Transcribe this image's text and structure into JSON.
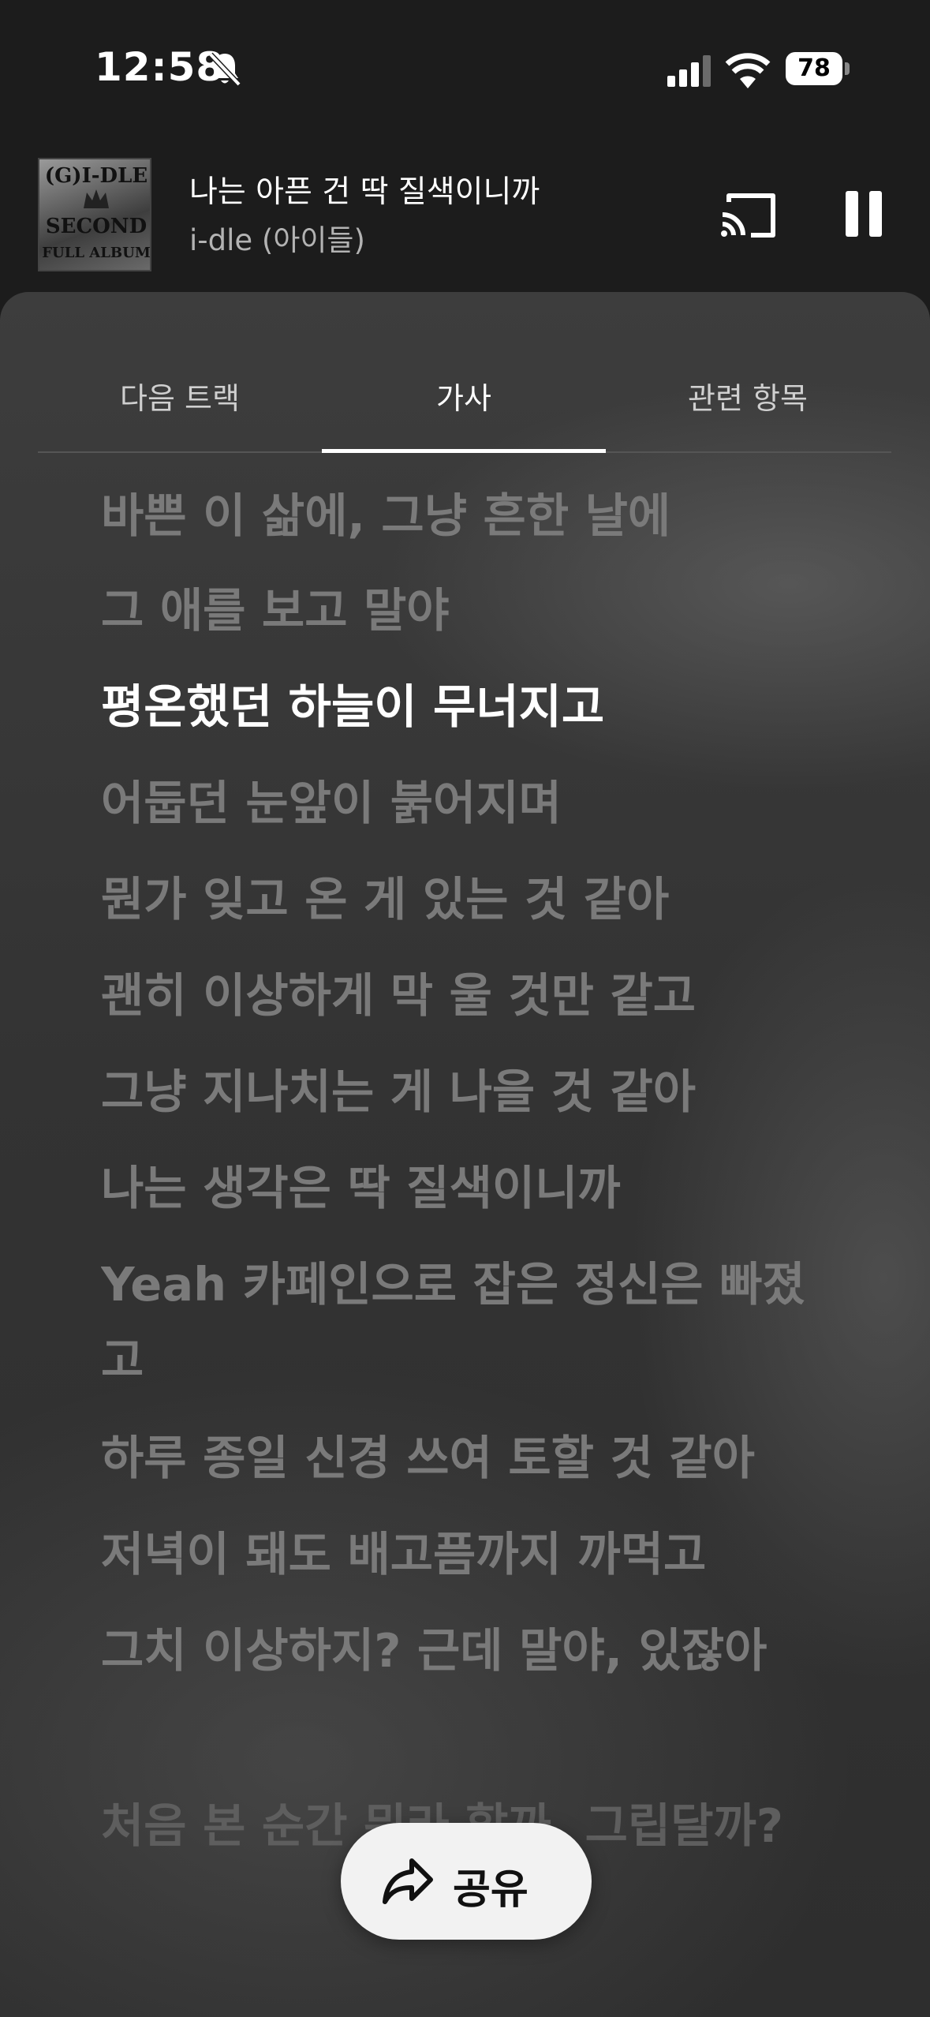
{
  "status_bar": {
    "time": "12:58",
    "battery": "78"
  },
  "player": {
    "album_art": {
      "line1": "(G)I-DLE",
      "line2": "SECOND",
      "line3": "FULL ALBUM"
    },
    "title": "나는 아픈 건 딱 질색이니까",
    "artist": "i-dle (아이들)"
  },
  "tabs": [
    {
      "label": "다음 트랙",
      "active": false
    },
    {
      "label": "가사",
      "active": true
    },
    {
      "label": "관련 항목",
      "active": false
    }
  ],
  "lyrics": [
    {
      "text": "바쁜 이 삶에, 그냥 흔한 날에",
      "state": "past"
    },
    {
      "text": "그 애를 보고 말야",
      "state": "past"
    },
    {
      "text": "평온했던 하늘이 무너지고",
      "state": "current"
    },
    {
      "text": "어둡던 눈앞이 붉어지며",
      "state": "upcoming"
    },
    {
      "text": "뭔가 잊고 온 게 있는 것 같아",
      "state": "upcoming"
    },
    {
      "text": "괜히 이상하게 막 울 것만 같고",
      "state": "upcoming"
    },
    {
      "text": "그냥 지나치는 게 나을 것 같아",
      "state": "upcoming"
    },
    {
      "text": "나는 생각은 딱 질색이니까",
      "state": "upcoming"
    },
    {
      "text": "Yeah 카페인으로 잡은 정신은 빠졌고",
      "state": "upcoming"
    },
    {
      "text": "하루 종일 신경 쓰여 토할 것 같아",
      "state": "upcoming"
    },
    {
      "text": "저녁이 돼도 배고픔까지 까먹고",
      "state": "upcoming"
    },
    {
      "text": "그치 이상하지? 근데 말야, 있잖아",
      "state": "upcoming"
    },
    {
      "text": "처음 본 순간 뭐라 할까, 그립달까?",
      "state": "upcoming"
    }
  ],
  "share": {
    "label": "공유"
  },
  "colors": {
    "active_lyric": "#ffffff",
    "inactive_lyric": "#7a7a7a",
    "share_background": "#f2f2f2"
  }
}
